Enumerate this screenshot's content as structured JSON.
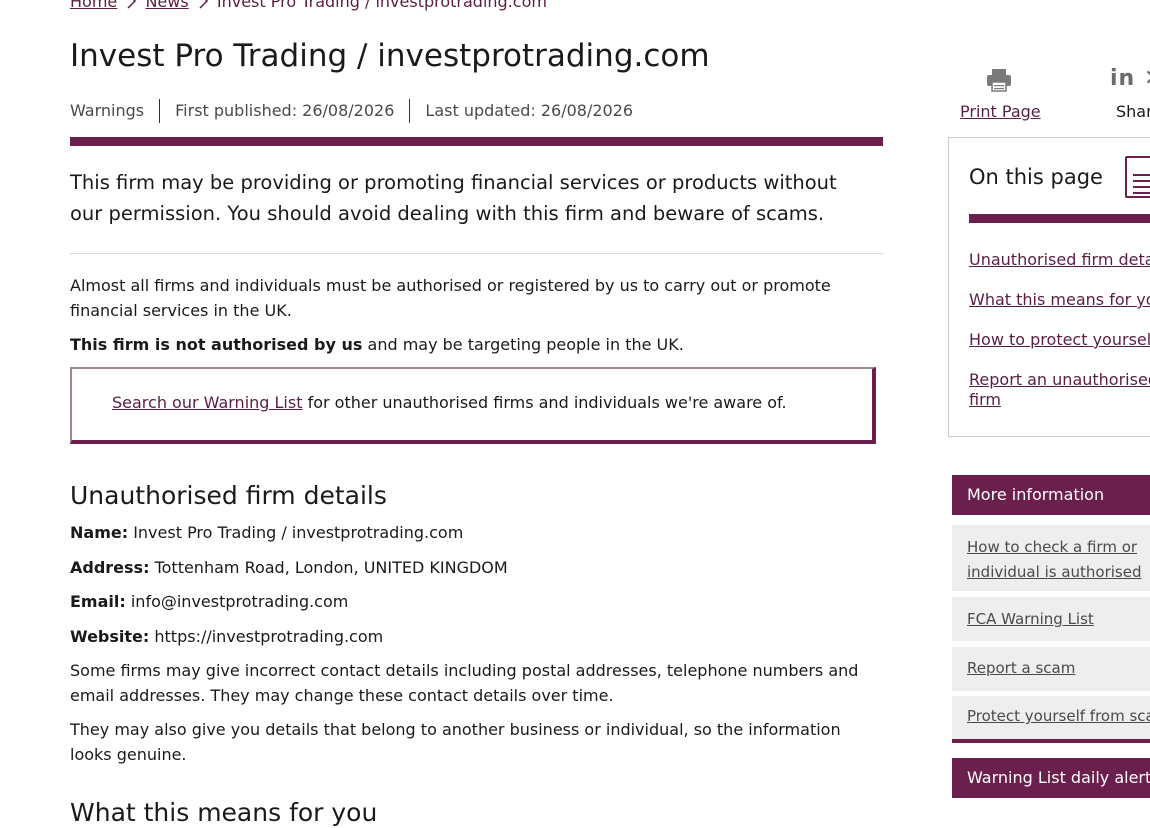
{
  "breadcrumb": {
    "home": "Home",
    "news": "News",
    "current": "Invest Pro Trading / investprotrading.com"
  },
  "page": {
    "title": "Invest Pro Trading / investprotrading.com",
    "meta": {
      "category": "Warnings",
      "first_published": "First published: 26/08/2026",
      "last_updated": "Last updated: 26/08/2026"
    },
    "lead": "This firm may be providing or promoting financial services or products without our permission. You should avoid dealing with this firm and beware of scams.",
    "intro": "Almost all firms and individuals must be authorised or registered by us to carry out or promote financial services in the UK.",
    "not_authorised_bold": "This firm is not authorised by us",
    "not_authorised_rest": " and may be targeting people in the UK.",
    "callout": {
      "link": "Search our Warning List",
      "text": " for other unauthorised firms and individuals we're aware of."
    },
    "details_heading": "Unauthorised firm details",
    "details": {
      "name_label": "Name:",
      "name_value": " Invest Pro Trading / investprotrading.com",
      "address_label": "Address:",
      "address_value": " Tottenham Road, London, UNITED KINGDOM",
      "email_label": "Email:",
      "email_value": " info@investprotrading.com",
      "website_label": "Website:",
      "website_value": " https://investprotrading.com"
    },
    "para_contact": "Some firms may give incorrect contact details including postal addresses, telephone numbers and email addresses. They may change these contact details over time.",
    "para_genuine": "They may also give you details that belong to another business or individual, so the information looks genuine.",
    "next_heading": "What this means for you"
  },
  "share": {
    "print_label": "Print Page",
    "share_label": "Share",
    "icons": [
      "print-icon",
      "linkedin-icon",
      "x-icon"
    ]
  },
  "on_this_page": {
    "title": "On this page",
    "items": [
      "Unauthorised firm details",
      "What this means for you",
      "How to protect yourself",
      "Report an unauthorised firm"
    ]
  },
  "more_information": {
    "title": "More information",
    "items": [
      "How to check a firm or individual is authorised",
      "FCA Warning List",
      "Report a scam",
      "Protect yourself from scams"
    ]
  },
  "warning_alerts": {
    "title": "Warning List daily alerts"
  },
  "colors": {
    "brand": "#6b1f4d",
    "link": "#5a1e44"
  }
}
